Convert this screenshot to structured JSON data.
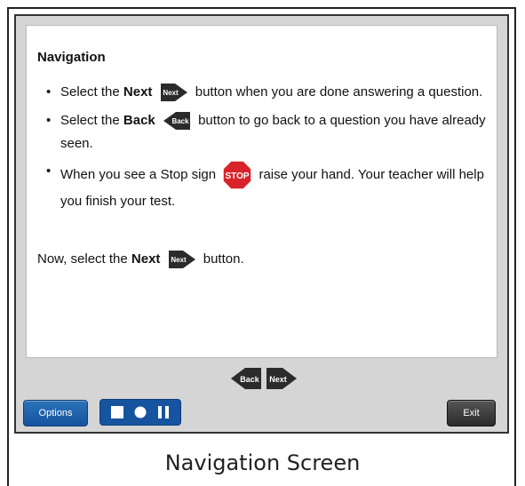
{
  "content": {
    "heading": "Navigation",
    "bullets": [
      {
        "pre": "Select the ",
        "bold": "Next",
        "post": " button when you are done answering a question."
      },
      {
        "pre": "Select the ",
        "bold": "Back",
        "post": " button to go back to a question you have already seen."
      },
      {
        "pre": "When you see a Stop sign ",
        "bold": "",
        "post": " raise your hand. Your teacher will help you finish your test."
      }
    ],
    "closing": {
      "pre": "Now, select the ",
      "bold": "Next",
      "post": " button."
    }
  },
  "icons": {
    "next_label": "Next",
    "back_label": "Back",
    "stop_label": "STOP"
  },
  "nav": {
    "back_label": "Back",
    "next_label": "Next"
  },
  "toolbar": {
    "options_label": "Options",
    "exit_label": "Exit"
  },
  "caption": "Navigation Screen",
  "colors": {
    "toolbar_blue": "#1654a0",
    "stop_red": "#d8232a",
    "arrow_dark": "#2b2b2b"
  }
}
